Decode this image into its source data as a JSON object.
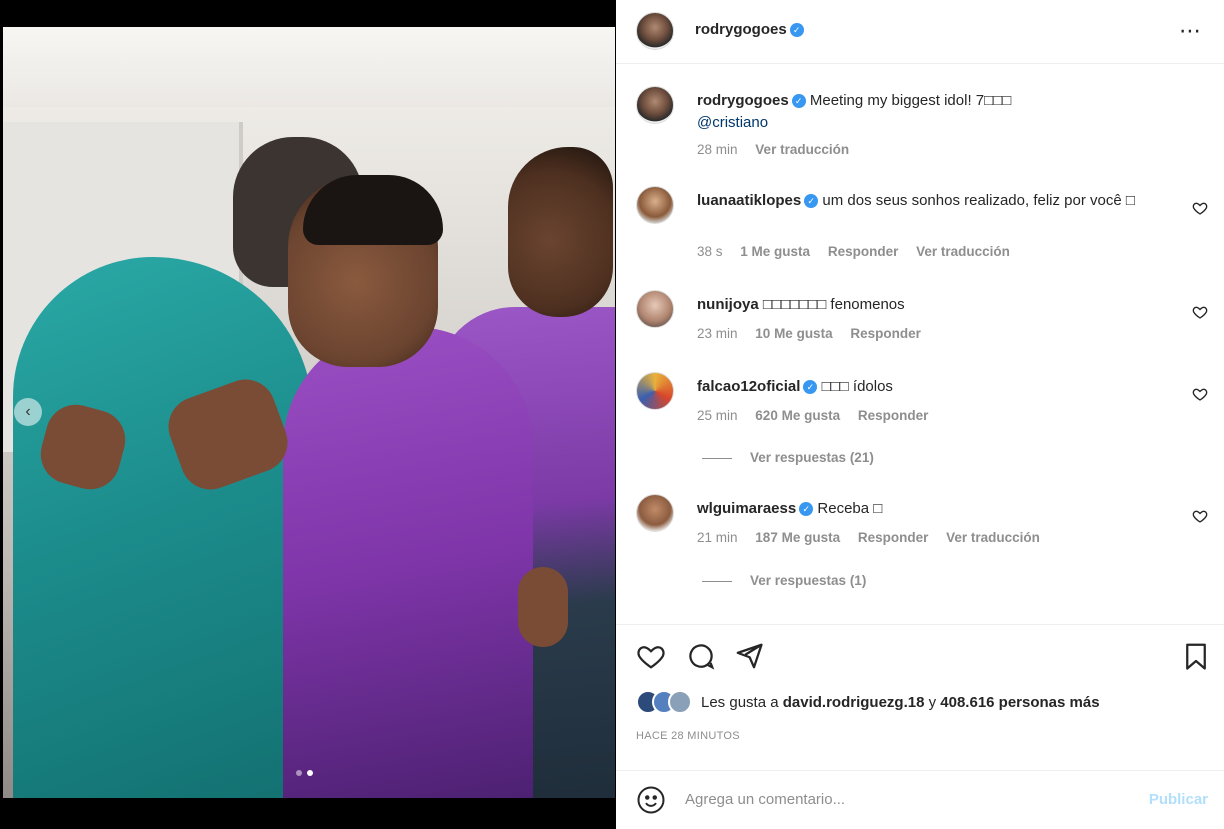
{
  "post": {
    "author": "rodrygogoes",
    "caption_text": "Meeting my biggest idol! 7□□□",
    "caption_mention": "@cristiano",
    "caption_time": "28 min",
    "caption_translate": "Ver traducción",
    "more_icon": "⋯"
  },
  "comments": [
    {
      "user": "luanaatiklopes",
      "verified": true,
      "text": "um dos seus sonhos realizado, feliz por você □",
      "time": "38 s",
      "likes": "1 Me gusta",
      "reply": "Responder",
      "translate": "Ver traducción"
    },
    {
      "user": "nunijoya",
      "verified": false,
      "text": "□□□□□□□ fenomenos",
      "time": "23 min",
      "likes": "10 Me gusta",
      "reply": "Responder"
    },
    {
      "user": "falcao12oficial",
      "verified": true,
      "text": "□□□ ídolos",
      "time": "25 min",
      "likes": "620 Me gusta",
      "reply": "Responder",
      "replies_label": "Ver respuestas (21)"
    },
    {
      "user": "wlguimaraess",
      "verified": true,
      "text": "Receba □",
      "time": "21 min",
      "likes": "187 Me gusta",
      "reply": "Responder",
      "translate": "Ver traducción",
      "replies_label": "Ver respuestas (1)"
    }
  ],
  "likes": {
    "prefix": "Les gusta a",
    "user": "david.rodriguezg.18",
    "middle": "y",
    "count": "408.616 personas más"
  },
  "time_ago": "HACE 28 MINUTOS",
  "add_comment": {
    "placeholder": "Agrega un comentario...",
    "publish": "Publicar"
  },
  "carousel": {
    "prev_icon": "‹"
  },
  "colors": {
    "verified": "#3897f0",
    "publish_disabled": "#b2dffc",
    "muted": "#8e8e8e"
  }
}
